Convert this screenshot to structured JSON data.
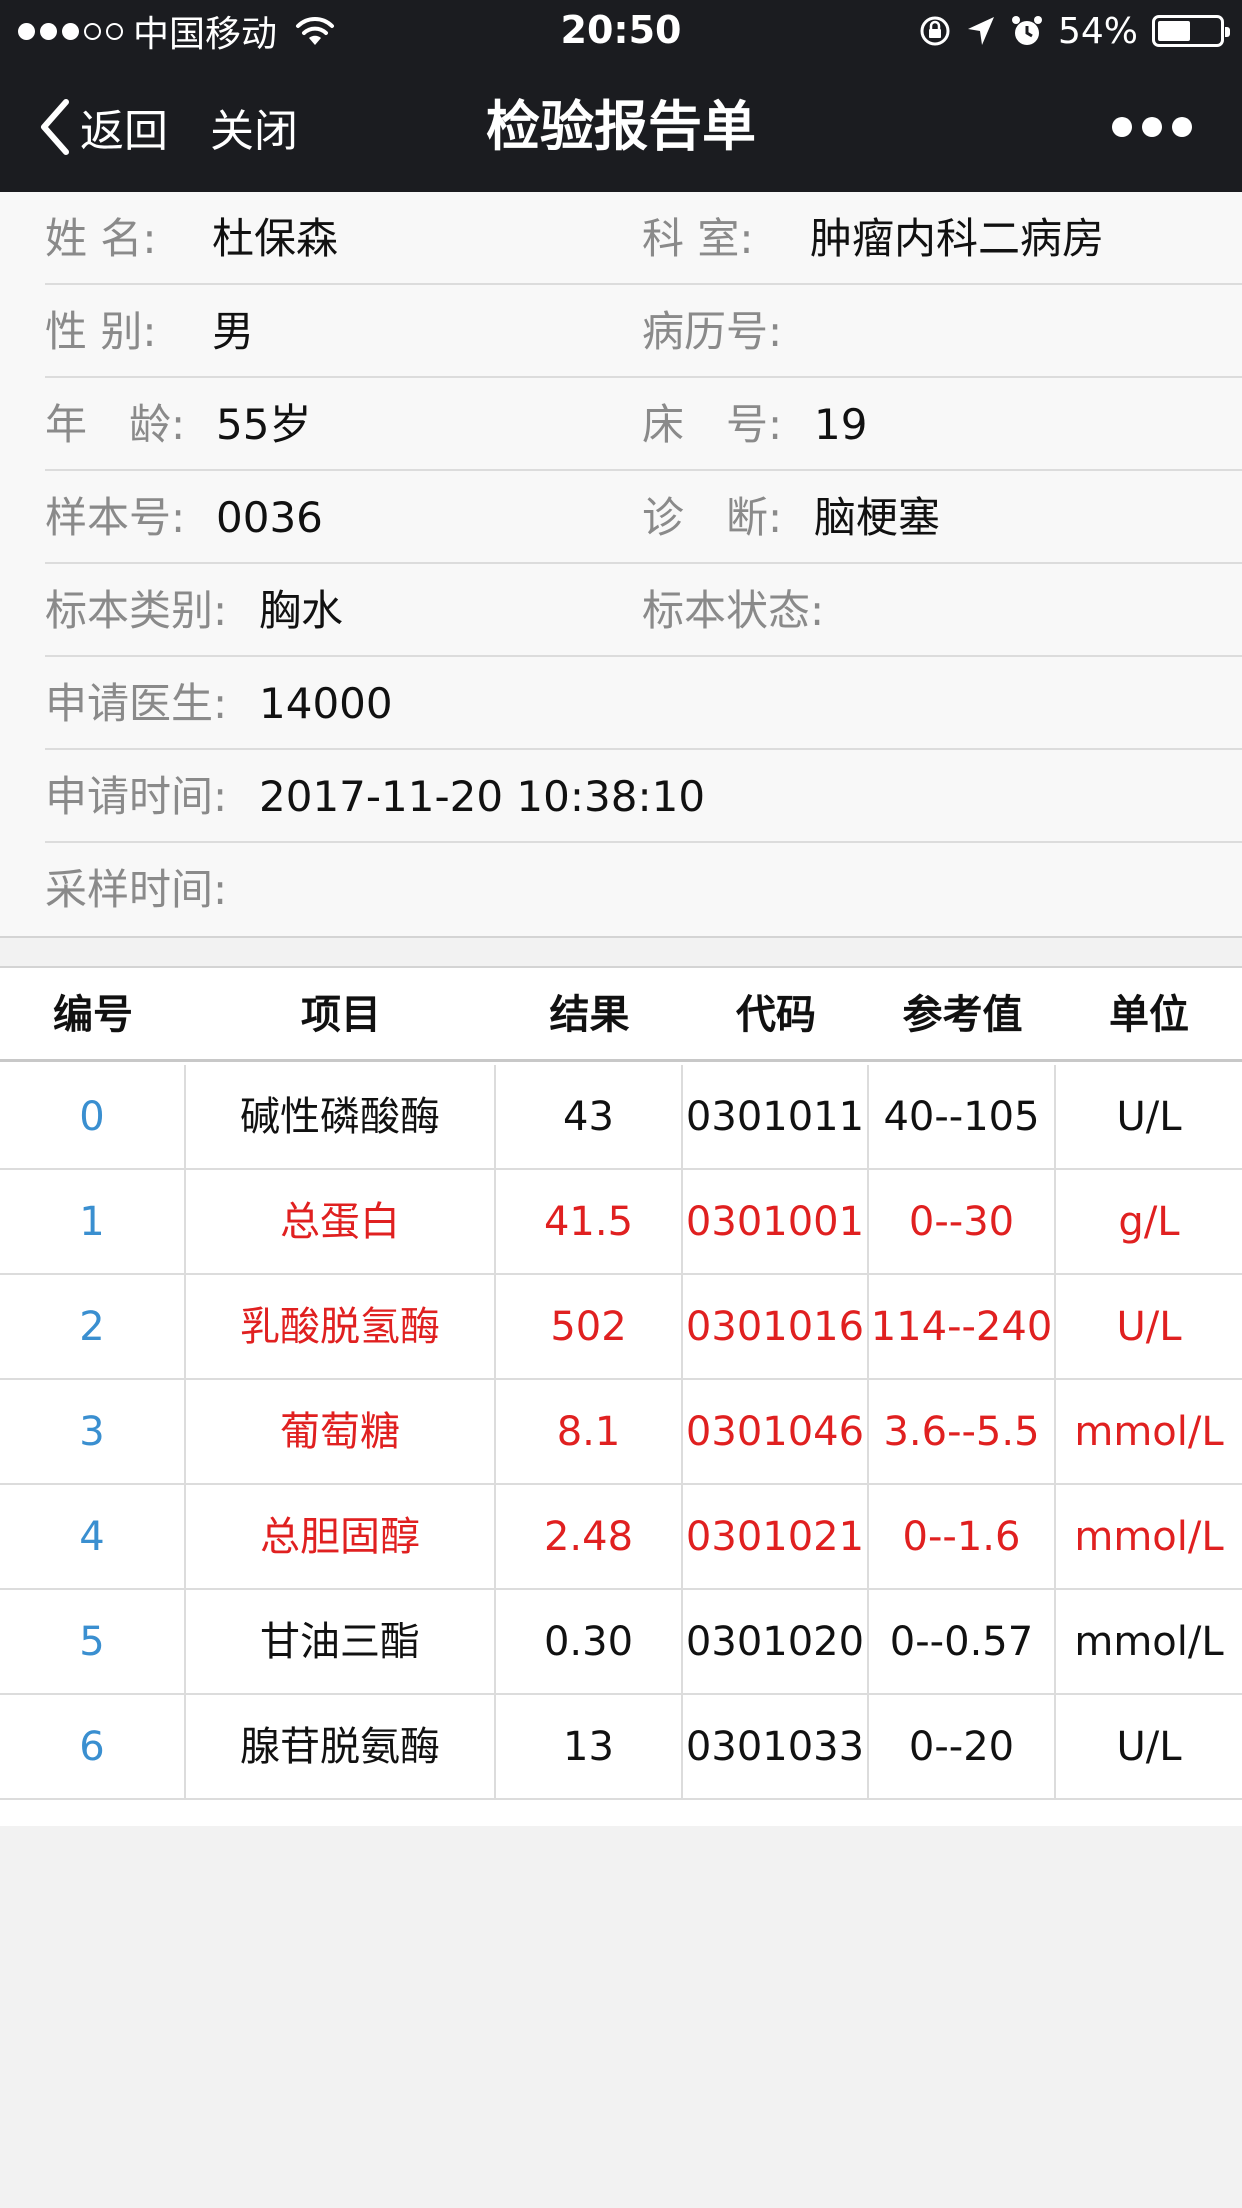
{
  "status_bar": {
    "carrier": "中国移动",
    "time": "20:50",
    "battery_percent": "54%",
    "battery_level": 0.54,
    "icons": [
      "signal-dots-icon",
      "wifi-icon",
      "orientation-lock-icon",
      "location-arrow-icon",
      "alarm-icon",
      "battery-icon"
    ]
  },
  "nav": {
    "back_label": "返回",
    "close_label": "关闭",
    "title": "检验报告单",
    "more_icon": "more-dots-icon"
  },
  "patient": {
    "name_label": "姓 名:",
    "name": "杜保森",
    "dept_label": "科 室:",
    "dept": "肿瘤内科二病房",
    "gender_label": "性 别:",
    "gender": "男",
    "record_label": "病历号:",
    "record": "",
    "age_label": "年　龄:",
    "age": "55岁",
    "bed_label": "床　号:",
    "bed": "19",
    "sample_label": "样本号:",
    "sample": "0036",
    "diagnosis_label": "诊　断:",
    "diagnosis": "脑梗塞",
    "specimen_type_label": "标本类别:",
    "specimen_type": "胸水",
    "specimen_status_label": "标本状态:",
    "specimen_status": "",
    "doctor_label": "申请医生:",
    "doctor": "14000",
    "request_time_label": "申请时间:",
    "request_time": "2017-11-20 10:38:10",
    "sample_time_label": "采样时间:",
    "sample_time": ""
  },
  "table": {
    "headers": [
      "编号",
      "项目",
      "结果",
      "代码",
      "参考值",
      "单位"
    ],
    "rows": [
      {
        "idx": "0",
        "item": "碱性磷酸酶",
        "result": "43",
        "code": "0301011",
        "ref": "40--105",
        "unit": "U/L",
        "abnormal": false
      },
      {
        "idx": "1",
        "item": "总蛋白",
        "result": "41.5",
        "code": "0301001",
        "ref": "0--30",
        "unit": "g/L",
        "abnormal": true
      },
      {
        "idx": "2",
        "item": "乳酸脱氢酶",
        "result": "502",
        "code": "0301016",
        "ref": "114--240",
        "unit": "U/L",
        "abnormal": true
      },
      {
        "idx": "3",
        "item": "葡萄糖",
        "result": "8.1",
        "code": "0301046",
        "ref": "3.6--5.5",
        "unit": "mmol/L",
        "abnormal": true
      },
      {
        "idx": "4",
        "item": "总胆固醇",
        "result": "2.48",
        "code": "0301021",
        "ref": "0--1.6",
        "unit": "mmol/L",
        "abnormal": true
      },
      {
        "idx": "5",
        "item": "甘油三酯",
        "result": "0.30",
        "code": "0301020",
        "ref": "0--0.57",
        "unit": "mmol/L",
        "abnormal": false
      },
      {
        "idx": "6",
        "item": "腺苷脱氨酶",
        "result": "13",
        "code": "0301033",
        "ref": "0--20",
        "unit": "U/L",
        "abnormal": false
      }
    ]
  },
  "colors": {
    "header_bg": "#1b1c20",
    "abnormal": "#e02020",
    "index": "#3a8fd0",
    "label": "#8a8a8a"
  }
}
